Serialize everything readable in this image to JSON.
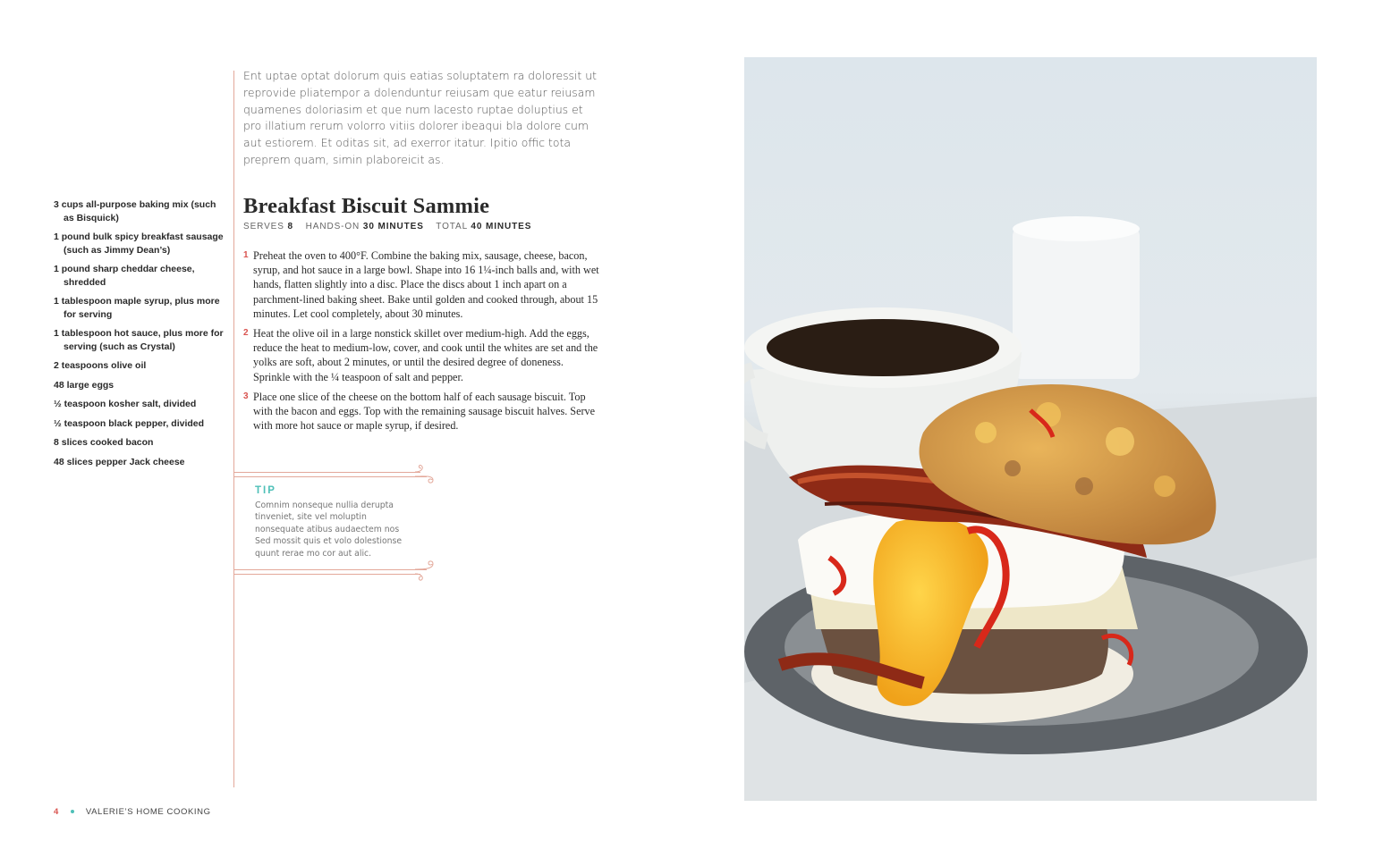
{
  "intro": "Ent uptae optat dolorum quis eatias soluptatem ra doloressit ut reprovide pliatempor a dolenduntur reiusam que eatur reiusam quamenes doloriasim et que num lacesto ruptae doluptius et pro illatium rerum volorro vitiis dolorer ibeaqui bla dolore cum aut estiorem. Et oditas sit, ad exerror itatur. Ipitio offic tota preprem quam, simin plaboreicit as.",
  "recipe": {
    "title": "Breakfast Biscuit Sammie",
    "serves_label": "SERVES",
    "serves_value": "8",
    "hands_on_label": "HANDS-ON",
    "hands_on_value": "30 MINUTES",
    "total_label": "TOTAL",
    "total_value": "40 MINUTES"
  },
  "ingredients": [
    "3 cups all-purpose baking mix (such as Bisquick)",
    "1 pound bulk spicy breakfast sausage (such as Jimmy Dean’s)",
    "1 pound sharp cheddar cheese, shredded",
    "1 tablespoon maple syrup, plus more for serving",
    "1 tablespoon hot sauce, plus more for serving (such as Crystal)",
    "2 teaspoons olive oil",
    "48 large eggs",
    "½ teaspoon kosher salt, divided",
    "½ teaspoon black pepper, divided",
    "8 slices cooked bacon",
    "48 slices pepper Jack cheese"
  ],
  "steps": [
    {
      "num": "1",
      "text": "Preheat the oven to 400°F. Combine the baking mix, sausage, cheese, bacon, syrup, and hot sauce in a large bowl. Shape into 16 1¼-inch balls and, with wet hands, flatten slightly into a disc. Place the discs about 1 inch apart on a parchment-lined baking sheet. Bake until golden and cooked through, about 15 minutes. Let cool completely, about 30 minutes."
    },
    {
      "num": "2",
      "text": "Heat the olive oil in a large nonstick skillet over medium-high. Add the eggs, reduce the heat to medium-low, cover, and cook until the whites are set and the yolks are soft, about 2 minutes, or until the desired degree of doneness. Sprinkle with the ¼ teaspoon of salt and pepper."
    },
    {
      "num": "3",
      "text": "Place one slice of the cheese on the bottom half of each sausage biscuit. Top with the bacon and eggs. Top with the remaining sausage biscuit halves. Serve with more hot sauce or maple syrup, if desired."
    }
  ],
  "tip": {
    "label": "TIP",
    "text": "Comnim nonseque nullia derupta tinveniet, site vel moluptin nonsequate atibus audaectem nos Sed mossit quis et volo dolestionse quunt rerae mo cor aut alic."
  },
  "footer": {
    "page_number": "4",
    "book_title": "VALERIE’S HOME COOKING"
  },
  "colors": {
    "accent_red": "#d9534f",
    "accent_teal": "#4fc0b8",
    "rule": "#e3a89a"
  }
}
